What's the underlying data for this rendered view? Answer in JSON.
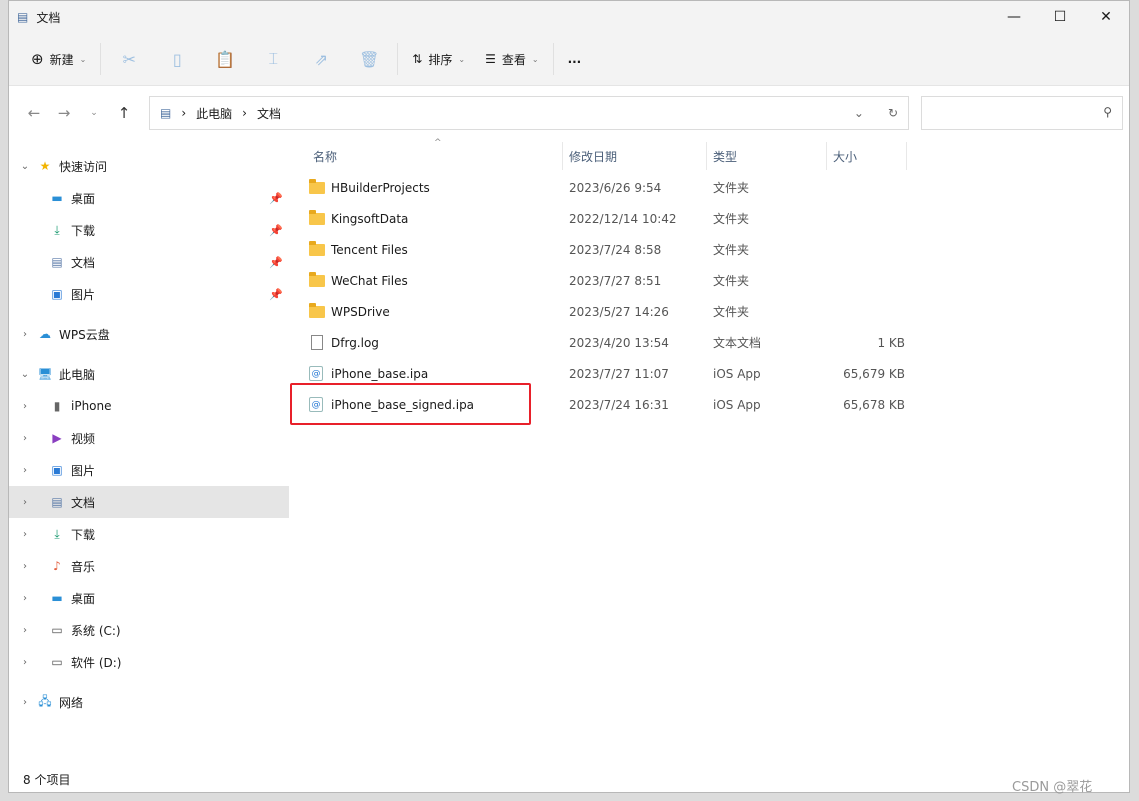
{
  "window": {
    "title": "文档"
  },
  "toolbar": {
    "new": "新建",
    "sort": "排序",
    "view": "查看",
    "more": "..."
  },
  "address": {
    "path": [
      "此电脑",
      "文档"
    ],
    "search_placeholder": ""
  },
  "sidebar": {
    "items": [
      {
        "label": "快速访问",
        "icon": "star-icon",
        "level": 0,
        "expand": "v"
      },
      {
        "label": "桌面",
        "icon": "desktop-icon",
        "level": 1,
        "pin": true
      },
      {
        "label": "下载",
        "icon": "download-icon",
        "level": 1,
        "pin": true
      },
      {
        "label": "文档",
        "icon": "document-icon",
        "level": 1,
        "pin": true
      },
      {
        "label": "图片",
        "icon": "pictures-icon",
        "level": 1,
        "pin": true
      },
      {
        "label": "WPS云盘",
        "icon": "cloud-icon",
        "level": 0,
        "expand": ">"
      },
      {
        "label": "此电脑",
        "icon": "computer-icon",
        "level": 0,
        "expand": "v"
      },
      {
        "label": "iPhone",
        "icon": "phone-icon",
        "level": 1,
        "expand": ">"
      },
      {
        "label": "视频",
        "icon": "video-icon",
        "level": 1,
        "expand": ">"
      },
      {
        "label": "图片",
        "icon": "pictures-icon",
        "level": 1,
        "expand": ">"
      },
      {
        "label": "文档",
        "icon": "document-icon",
        "level": 1,
        "expand": ">",
        "selected": true
      },
      {
        "label": "下载",
        "icon": "download-icon",
        "level": 1,
        "expand": ">"
      },
      {
        "label": "音乐",
        "icon": "music-icon",
        "level": 1,
        "expand": ">"
      },
      {
        "label": "桌面",
        "icon": "desktop-icon",
        "level": 1,
        "expand": ">"
      },
      {
        "label": "系统 (C:)",
        "icon": "drive-icon",
        "level": 1,
        "expand": ">"
      },
      {
        "label": "软件 (D:)",
        "icon": "drive-icon",
        "level": 1,
        "expand": ">"
      },
      {
        "label": "网络",
        "icon": "network-icon",
        "level": 0,
        "expand": ">"
      }
    ]
  },
  "columns": {
    "name": "名称",
    "date": "修改日期",
    "type": "类型",
    "size": "大小"
  },
  "files": [
    {
      "name": "HBuilderProjects",
      "date": "2023/6/26 9:54",
      "type": "文件夹",
      "size": "",
      "kind": "folder"
    },
    {
      "name": "KingsoftData",
      "date": "2022/12/14 10:42",
      "type": "文件夹",
      "size": "",
      "kind": "folder"
    },
    {
      "name": "Tencent Files",
      "date": "2023/7/24 8:58",
      "type": "文件夹",
      "size": "",
      "kind": "folder"
    },
    {
      "name": "WeChat Files",
      "date": "2023/7/27 8:51",
      "type": "文件夹",
      "size": "",
      "kind": "folder"
    },
    {
      "name": "WPSDrive",
      "date": "2023/5/27 14:26",
      "type": "文件夹",
      "size": "",
      "kind": "folder"
    },
    {
      "name": "Dfrg.log",
      "date": "2023/4/20 13:54",
      "type": "文本文档",
      "size": "1 KB",
      "kind": "file"
    },
    {
      "name": "iPhone_base.ipa",
      "date": "2023/7/27 11:07",
      "type": "iOS App",
      "size": "65,679 KB",
      "kind": "ipa"
    },
    {
      "name": "iPhone_base_signed.ipa",
      "date": "2023/7/24 16:31",
      "type": "iOS App",
      "size": "65,678 KB",
      "kind": "ipa"
    }
  ],
  "status": {
    "count": "8 个项目"
  },
  "watermark": "CSDN @翠花"
}
